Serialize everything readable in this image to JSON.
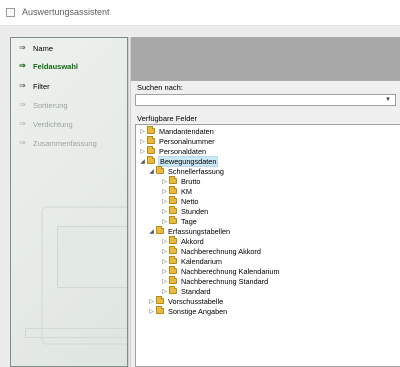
{
  "window": {
    "title": "Auswertungsassistent"
  },
  "nav": {
    "items": [
      {
        "label": "Name",
        "state": "done"
      },
      {
        "label": "Feldauswahl",
        "state": "active"
      },
      {
        "label": "Filter",
        "state": "done"
      },
      {
        "label": "Sortierung",
        "state": "disabled"
      },
      {
        "label": "Verdichtung",
        "state": "disabled"
      },
      {
        "label": "Zusammenfassung",
        "state": "disabled"
      }
    ]
  },
  "search": {
    "label": "Suchen nach:",
    "value": ""
  },
  "fields": {
    "label": "Verfügbare Felder",
    "tree": [
      {
        "label": "Mandantendaten",
        "expander": "collapsed"
      },
      {
        "label": "Personalnummer",
        "expander": "collapsed"
      },
      {
        "label": "Personaldaten",
        "expander": "collapsed"
      },
      {
        "label": "Bewegungsdaten",
        "expander": "expanded",
        "selected": true
      },
      {
        "label": "Schnellerfassung",
        "expander": "expanded"
      },
      {
        "label": "Brutto",
        "expander": "collapsed"
      },
      {
        "label": "KM",
        "expander": "collapsed"
      },
      {
        "label": "Netto",
        "expander": "collapsed"
      },
      {
        "label": "Stunden",
        "expander": "collapsed"
      },
      {
        "label": "Tage",
        "expander": "collapsed"
      },
      {
        "label": "Erfassungstabellen",
        "expander": "expanded"
      },
      {
        "label": "Akkord",
        "expander": "collapsed"
      },
      {
        "label": "Nachberechnung Akkord",
        "expander": "collapsed"
      },
      {
        "label": "Kalendarium",
        "expander": "collapsed"
      },
      {
        "label": "Nachberechnung Kalendarium",
        "expander": "collapsed"
      },
      {
        "label": "Nachberechnung Standard",
        "expander": "collapsed"
      },
      {
        "label": "Standard",
        "expander": "collapsed"
      },
      {
        "label": "Vorschusstabelle",
        "expander": "collapsed"
      },
      {
        "label": "Sonstige Angaben",
        "expander": "collapsed"
      }
    ]
  }
}
